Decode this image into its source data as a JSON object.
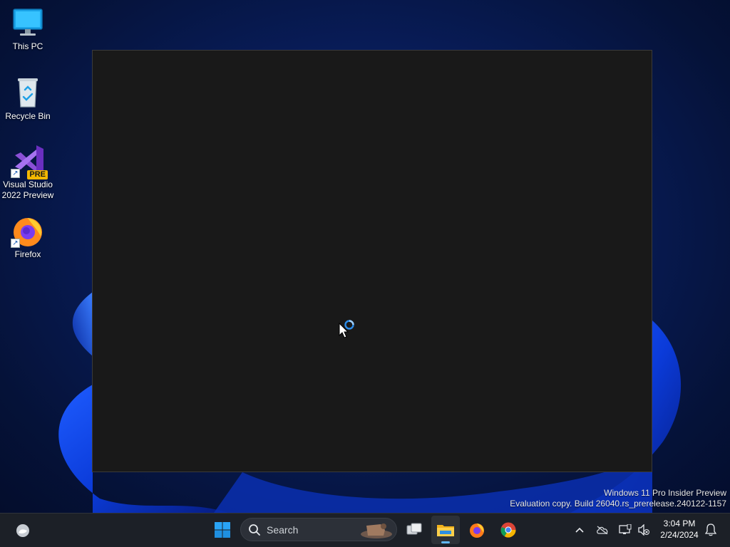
{
  "desktop": {
    "icons": [
      {
        "label": "This PC",
        "icon": "computer-icon"
      },
      {
        "label": "Recycle Bin",
        "icon": "recycle-bin-icon"
      },
      {
        "label": "Visual Studio\n2022 Preview",
        "label_line1": "Visual Studio",
        "label_line2": "2022 Preview",
        "badge": "PRE",
        "icon": "visual-studio-icon"
      },
      {
        "label": "Firefox",
        "icon": "firefox-icon"
      }
    ]
  },
  "watermark": {
    "line1": "Windows 11 Pro Insider Preview",
    "line2": "Evaluation copy. Build 26040.rs_prerelease.240122-1157"
  },
  "taskbar": {
    "search_placeholder": "Search",
    "apps": [
      "widgets-icon",
      "start-icon",
      "task-view-icon",
      "file-explorer-icon",
      "firefox-icon",
      "chrome-icon"
    ],
    "active_app": "file-explorer-icon",
    "tray_icons": [
      "chevron-up-icon",
      "onedrive-icon",
      "network-icon",
      "volume-muted-icon",
      "notification-bell-icon"
    ],
    "clock": {
      "time": "3:04 PM",
      "date": "2/24/2024"
    }
  },
  "colors": {
    "accent": "#60b5f0",
    "taskbar_bg": "#1c2027",
    "window_bg": "#191919"
  }
}
